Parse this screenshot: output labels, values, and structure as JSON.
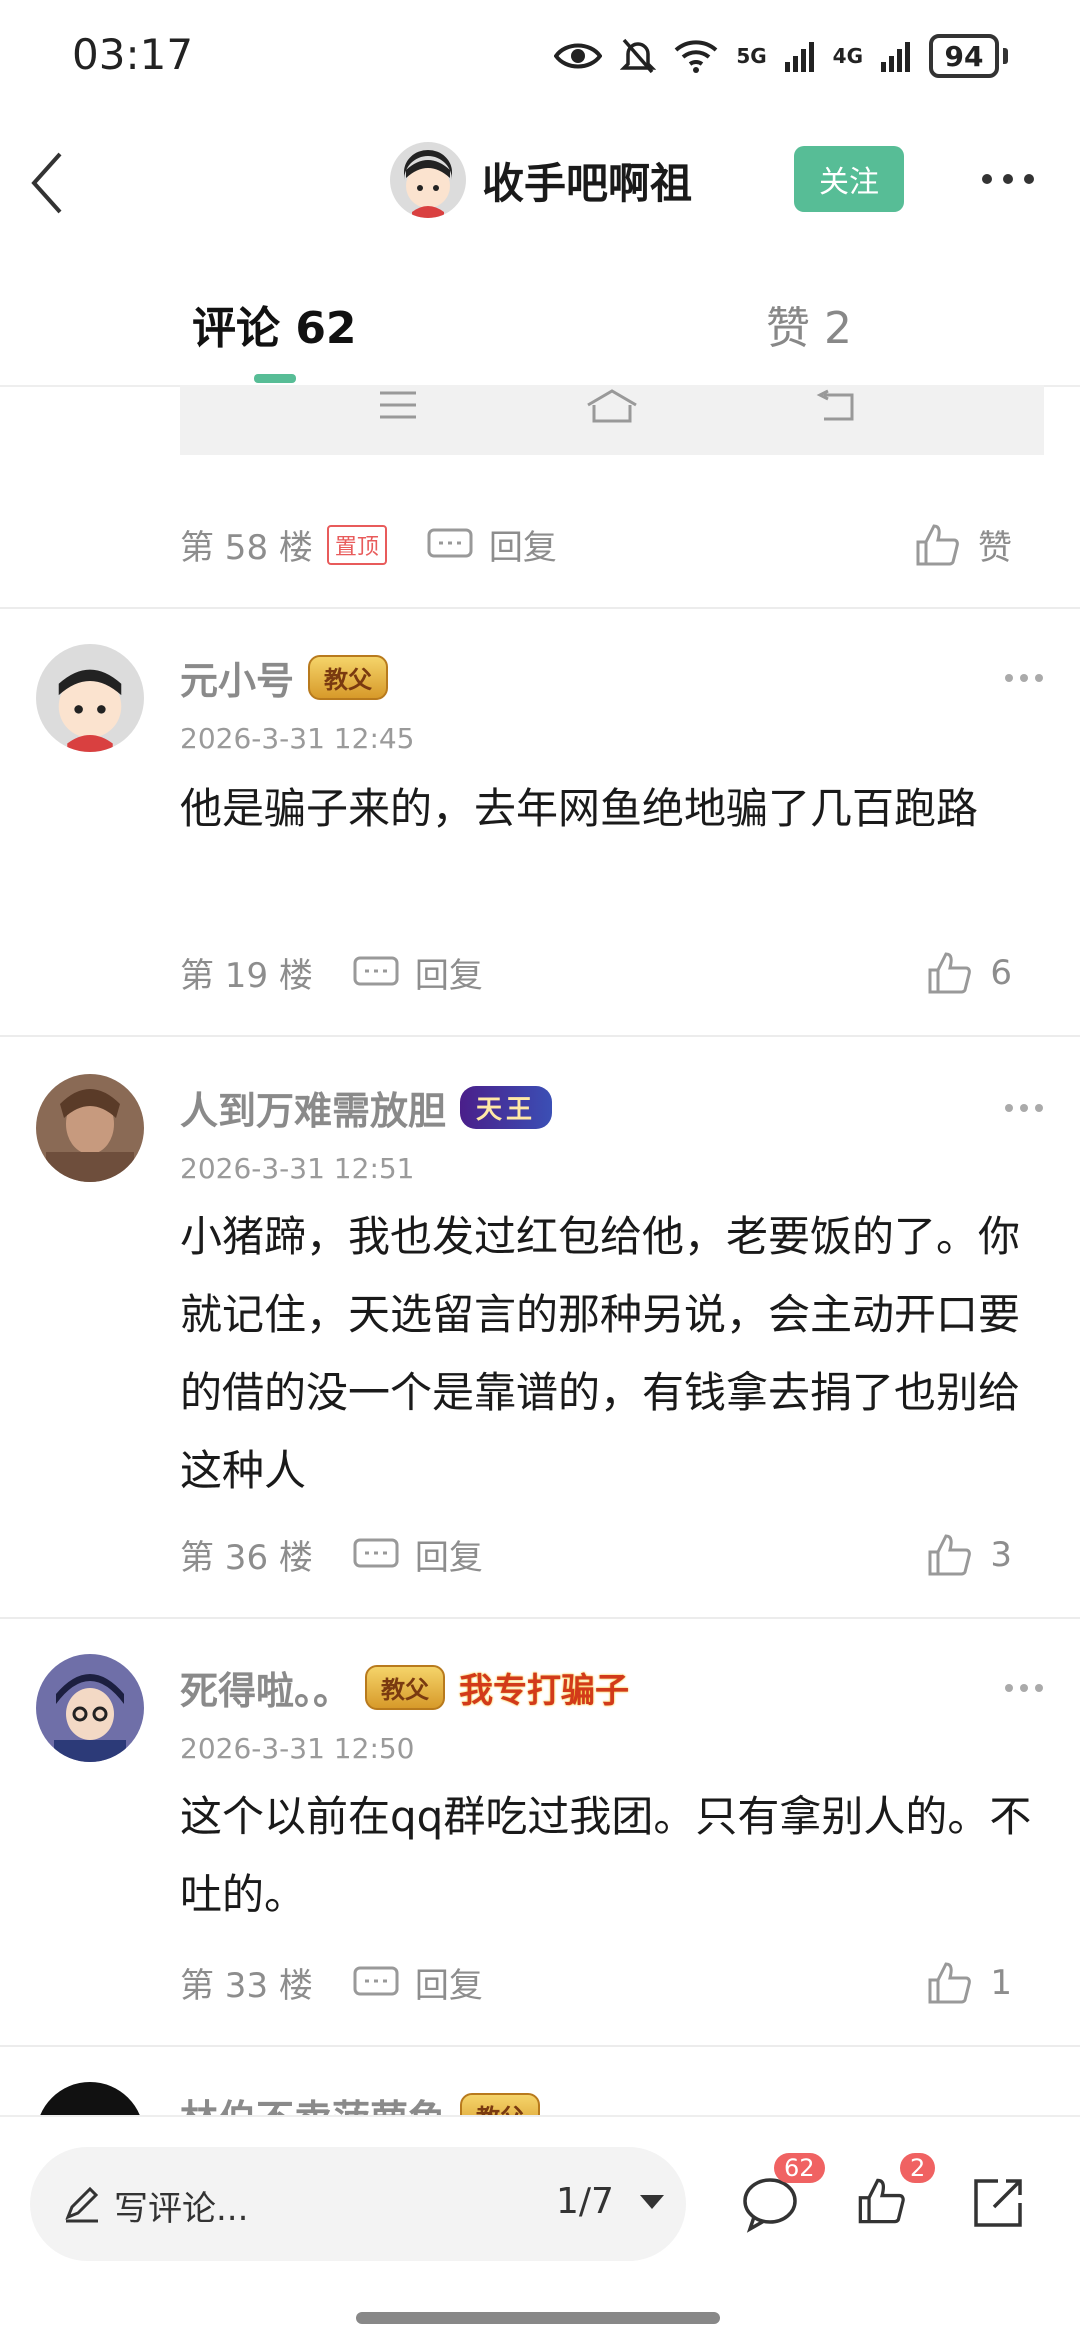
{
  "status_bar": {
    "time": "03:17",
    "net5g": "5G",
    "net4g": "4G",
    "battery": "94"
  },
  "header": {
    "title": "收手吧啊祖",
    "follow_label": "关注"
  },
  "tabs": [
    {
      "label": "评论 62"
    },
    {
      "label": "赞 2"
    }
  ],
  "pinned": {
    "floor": "第 58 楼",
    "pin_badge": "置顶",
    "reply_label": "回复",
    "like_label": "赞"
  },
  "comments": [
    {
      "name": "元小号",
      "badge": "教父",
      "time": "2026-3-31 12:45",
      "text": "他是骗子来的，去年网鱼绝地骗了几百跑路",
      "floor": "第 19 楼",
      "reply_label": "回复",
      "likes": "6"
    },
    {
      "name": "人到万难需放胆",
      "badge": "天王",
      "time": "2026-3-31 12:51",
      "text": "小猪蹄，我也发过红包给他，老要饭的了。你就记住，天选留言的那种另说，会主动开口要的借的没一个是靠谱的，有钱拿去捐了也别给这种人",
      "floor": "第 36 楼",
      "reply_label": "回复",
      "likes": "3"
    },
    {
      "name": "死得啦。。",
      "badge": "教父",
      "badge2": "我专打骗子",
      "time": "2026-3-31 12:50",
      "text": "这个以前在qq群吃过我团。只有拿别人的。不吐的。",
      "floor": "第 33 楼",
      "reply_label": "回复",
      "likes": "1"
    },
    {
      "name": "林伯不卖菠萝鱼",
      "badge": "教父"
    }
  ],
  "bottom_bar": {
    "input_placeholder": "写评论...",
    "page": "1/7",
    "comment_count": "62",
    "like_count": "2"
  },
  "colors": {
    "accent": "#57bd96",
    "badge_red": "#f06262"
  }
}
